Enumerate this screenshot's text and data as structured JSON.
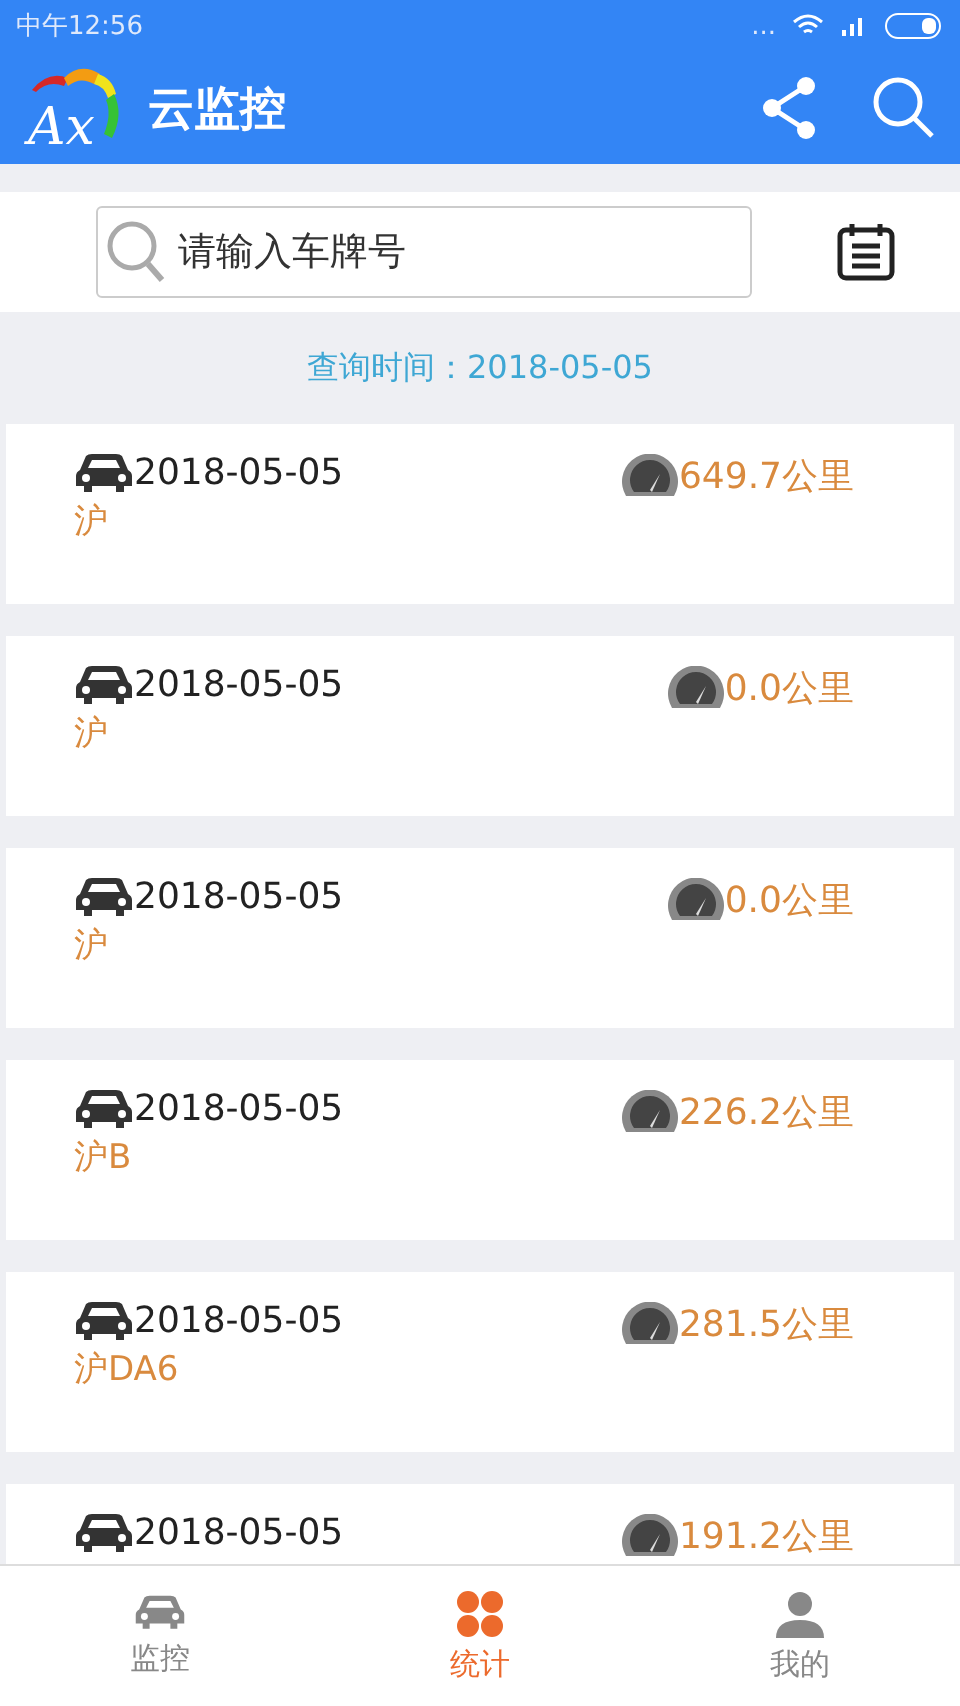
{
  "status_bar": {
    "time": "中午12:56",
    "dots": "..."
  },
  "app_bar": {
    "logo_text": "Ax",
    "title": "云监控"
  },
  "search": {
    "placeholder": "请输入车牌号"
  },
  "query_time": "查询时间：2018-05-05",
  "records": [
    {
      "date": "2018-05-05",
      "plate": "沪",
      "distance": "649.7公里"
    },
    {
      "date": "2018-05-05",
      "plate": "沪",
      "distance": "0.0公里"
    },
    {
      "date": "2018-05-05",
      "plate": "沪",
      "distance": "0.0公里"
    },
    {
      "date": "2018-05-05",
      "plate": "沪B",
      "distance": "226.2公里"
    },
    {
      "date": "2018-05-05",
      "plate": "沪DA6",
      "distance": "281.5公里"
    },
    {
      "date": "2018-05-05",
      "distance": "191.2公里"
    }
  ],
  "tabs": [
    {
      "label": "监控",
      "kind": "car",
      "selected": false
    },
    {
      "label": "统计",
      "kind": "clover",
      "selected": true
    },
    {
      "label": "我的",
      "kind": "person",
      "selected": false
    }
  ]
}
